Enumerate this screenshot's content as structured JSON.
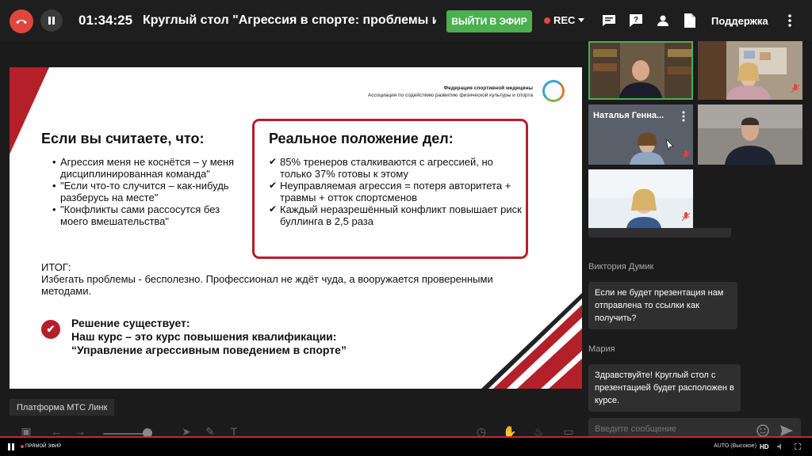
{
  "topbar": {
    "timer": "01:34:25",
    "title": "Круглый стол \"Агрессия в спорте: проблемы и пу",
    "air_button": "ВЫЙТИ В ЭФИР",
    "rec_label": "REC",
    "support_label": "Поддержка",
    "colors": {
      "hang": "#e0463d",
      "air": "#4caf50"
    }
  },
  "slide": {
    "org_line1": "Федерация спортивной медицины",
    "org_line2": "Ассоциация по содействию развитию физической культуры и спорта",
    "left_heading": "Если вы считаете, что:",
    "left_items": [
      "Агрессия меня не коснётся – у меня дисциплинированная команда\"",
      "\"Если что-то случится – как-нибудь разберусь на месте\"",
      "\"Конфликты сами рассосутся без моего вмешательства\""
    ],
    "box_heading": "Реальное положение дел:",
    "box_items": [
      "85% тренеров сталкиваются с агрессией, но только 37% готовы к этому",
      "Неуправляемая агрессия = потеря авторитета + травмы + отток спортсменов",
      "Каждый неразрешённый конфликт повышает риск буллинга в 2,5 раза"
    ],
    "itog_label": "ИТОГ:",
    "itog_text": "Избегать проблемы - бесполезно. Профессионал не ждёт чуда, а вооружается проверенными методами.",
    "solution_line1": "Решение существует:",
    "solution_line2": "Наш курс – это курс повышения квалификации:",
    "solution_line3": "“Управление агрессивным поведением в спорте”",
    "accent_color": "#b3202a"
  },
  "platform_label": "Платформа МТС Линк",
  "participants": [
    {
      "name": ""
    },
    {
      "name": ""
    },
    {
      "name": "Наталья Генна..."
    },
    {
      "name": ""
    },
    {
      "name": ""
    }
  ],
  "chat": {
    "messages": [
      {
        "author": "Виктория Думик",
        "text": "Если не будет презентация нам отправлена то ссылки как получить?"
      },
      {
        "author": "Мария",
        "text": "Здравствуйте! Круглый стол с презентацией будет расположен в курсе."
      }
    ],
    "input_placeholder": "Введите сообщение"
  },
  "player": {
    "live_label": "ПРЯМОЙ ЭФИР",
    "quality_label": "AUTO (Высокое)",
    "hd_label": "HD"
  }
}
